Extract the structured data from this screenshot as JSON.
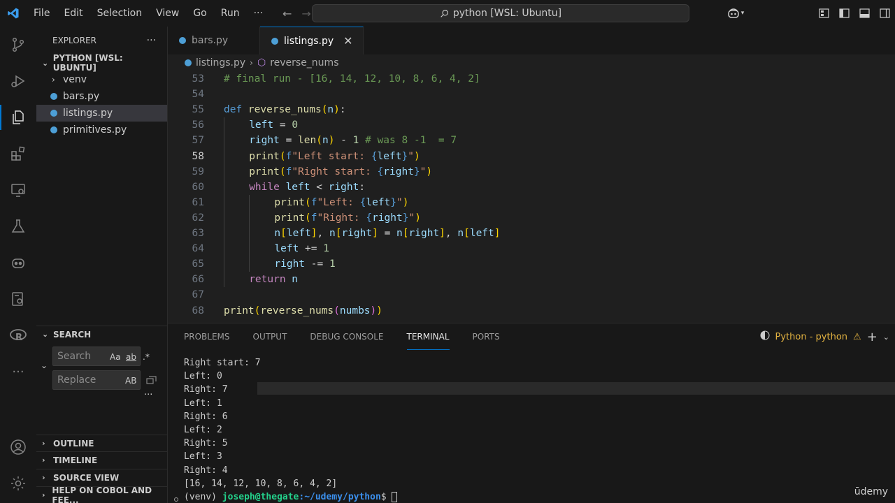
{
  "menu": [
    "File",
    "Edit",
    "Selection",
    "View",
    "Go",
    "Run",
    "···"
  ],
  "command_center": "python [WSL: Ubuntu]",
  "sidebar": {
    "explorer_title": "EXPLORER",
    "workspace": "PYTHON [WSL: UBUNTU]",
    "items": [
      {
        "label": "venv",
        "type": "folder"
      },
      {
        "label": "bars.py",
        "type": "file"
      },
      {
        "label": "listings.py",
        "type": "file",
        "selected": true
      },
      {
        "label": "primitives.py",
        "type": "file"
      }
    ],
    "search_title": "SEARCH",
    "search_placeholder": "Search",
    "replace_placeholder": "Replace",
    "search_flags": [
      "Aa",
      "ab",
      ".*"
    ],
    "replace_flag": "AB",
    "bottom_sections": [
      "OUTLINE",
      "TIMELINE",
      "SOURCE VIEW",
      "HELP ON COBOL AND FEE..."
    ]
  },
  "tabs": [
    {
      "label": "bars.py",
      "active": false
    },
    {
      "label": "listings.py",
      "active": true
    }
  ],
  "breadcrumb": [
    "listings.py",
    "reverse_nums"
  ],
  "code": {
    "current_line": 58,
    "lines": [
      {
        "n": 53,
        "indent": 0,
        "tokens": [
          [
            "c",
            "# final run - [16, 14, 12, 10, 8, 6, 4, 2]"
          ]
        ]
      },
      {
        "n": 54,
        "indent": 0,
        "tokens": []
      },
      {
        "n": 55,
        "indent": 0,
        "tokens": [
          [
            "k",
            "def "
          ],
          [
            "f",
            "reverse_nums"
          ],
          [
            "b1",
            "("
          ],
          [
            "v",
            "n"
          ],
          [
            "b1",
            ")"
          ],
          [
            "p",
            ":"
          ]
        ]
      },
      {
        "n": 56,
        "indent": 1,
        "tokens": [
          [
            "v",
            "left"
          ],
          [
            "p",
            " = "
          ],
          [
            "n",
            "0"
          ]
        ]
      },
      {
        "n": 57,
        "indent": 1,
        "tokens": [
          [
            "v",
            "right"
          ],
          [
            "p",
            " = "
          ],
          [
            "f",
            "len"
          ],
          [
            "b1",
            "("
          ],
          [
            "v",
            "n"
          ],
          [
            "b1",
            ")"
          ],
          [
            "p",
            " - "
          ],
          [
            "n",
            "1"
          ],
          [
            "c",
            " # was 8 -1  = 7"
          ]
        ]
      },
      {
        "n": 58,
        "indent": 1,
        "tokens": [
          [
            "f",
            "print"
          ],
          [
            "b1",
            "("
          ],
          [
            "k",
            "f"
          ],
          [
            "s",
            "\"Left start: "
          ],
          [
            "k",
            "{"
          ],
          [
            "v",
            "left"
          ],
          [
            "k",
            "}"
          ],
          [
            "s",
            "\""
          ],
          [
            "b1",
            ")"
          ]
        ]
      },
      {
        "n": 59,
        "indent": 1,
        "tokens": [
          [
            "f",
            "print"
          ],
          [
            "b1",
            "("
          ],
          [
            "k",
            "f"
          ],
          [
            "s",
            "\"Right start: "
          ],
          [
            "k",
            "{"
          ],
          [
            "v",
            "right"
          ],
          [
            "k",
            "}"
          ],
          [
            "s",
            "\""
          ],
          [
            "b1",
            ")"
          ]
        ]
      },
      {
        "n": 60,
        "indent": 1,
        "tokens": [
          [
            "kw",
            "while "
          ],
          [
            "v",
            "left"
          ],
          [
            "p",
            " < "
          ],
          [
            "v",
            "right"
          ],
          [
            "p",
            ":"
          ]
        ]
      },
      {
        "n": 61,
        "indent": 2,
        "tokens": [
          [
            "f",
            "print"
          ],
          [
            "b1",
            "("
          ],
          [
            "k",
            "f"
          ],
          [
            "s",
            "\"Left: "
          ],
          [
            "k",
            "{"
          ],
          [
            "v",
            "left"
          ],
          [
            "k",
            "}"
          ],
          [
            "s",
            "\""
          ],
          [
            "b1",
            ")"
          ]
        ]
      },
      {
        "n": 62,
        "indent": 2,
        "tokens": [
          [
            "f",
            "print"
          ],
          [
            "b1",
            "("
          ],
          [
            "k",
            "f"
          ],
          [
            "s",
            "\"Right: "
          ],
          [
            "k",
            "{"
          ],
          [
            "v",
            "right"
          ],
          [
            "k",
            "}"
          ],
          [
            "s",
            "\""
          ],
          [
            "b1",
            ")"
          ]
        ]
      },
      {
        "n": 63,
        "indent": 2,
        "tokens": [
          [
            "v",
            "n"
          ],
          [
            "b1",
            "["
          ],
          [
            "v",
            "left"
          ],
          [
            "b1",
            "]"
          ],
          [
            "p",
            ", "
          ],
          [
            "v",
            "n"
          ],
          [
            "b1",
            "["
          ],
          [
            "v",
            "right"
          ],
          [
            "b1",
            "]"
          ],
          [
            "p",
            " = "
          ],
          [
            "v",
            "n"
          ],
          [
            "b1",
            "["
          ],
          [
            "v",
            "right"
          ],
          [
            "b1",
            "]"
          ],
          [
            "p",
            ", "
          ],
          [
            "v",
            "n"
          ],
          [
            "b1",
            "["
          ],
          [
            "v",
            "left"
          ],
          [
            "b1",
            "]"
          ]
        ]
      },
      {
        "n": 64,
        "indent": 2,
        "tokens": [
          [
            "v",
            "left"
          ],
          [
            "p",
            " += "
          ],
          [
            "n",
            "1"
          ]
        ]
      },
      {
        "n": 65,
        "indent": 2,
        "tokens": [
          [
            "v",
            "right"
          ],
          [
            "p",
            " -= "
          ],
          [
            "n",
            "1"
          ]
        ]
      },
      {
        "n": 66,
        "indent": 1,
        "tokens": [
          [
            "kw",
            "return "
          ],
          [
            "v",
            "n"
          ]
        ]
      },
      {
        "n": 67,
        "indent": 0,
        "tokens": []
      },
      {
        "n": 68,
        "indent": 0,
        "tokens": [
          [
            "f",
            "print"
          ],
          [
            "b1",
            "("
          ],
          [
            "f",
            "reverse_nums"
          ],
          [
            "b2",
            "("
          ],
          [
            "v",
            "numbs"
          ],
          [
            "b2",
            ")"
          ],
          [
            "b1",
            ")"
          ]
        ]
      }
    ]
  },
  "panel": {
    "tabs": [
      "PROBLEMS",
      "OUTPUT",
      "DEBUG CONSOLE",
      "TERMINAL",
      "PORTS"
    ],
    "active_tab": "TERMINAL",
    "terminal_name": "Python - python",
    "terminal_lines": [
      "Right start: 7",
      "Left: 0",
      "Right: 7",
      "Left: 1",
      "Right: 6",
      "Left: 2",
      "Right: 5",
      "Left: 3",
      "Right: 4",
      "[16, 14, 12, 10, 8, 6, 4, 2]"
    ],
    "prompt_env": "(venv) ",
    "prompt_user": "joseph@thegate",
    "prompt_path": ":~/udemy/python",
    "prompt_symbol": "$ "
  },
  "watermark": "ūdemy",
  "colors": {
    "accent": "#0078d4",
    "editor_bg": "#1f1f1f",
    "sidebar_bg": "#181818"
  }
}
